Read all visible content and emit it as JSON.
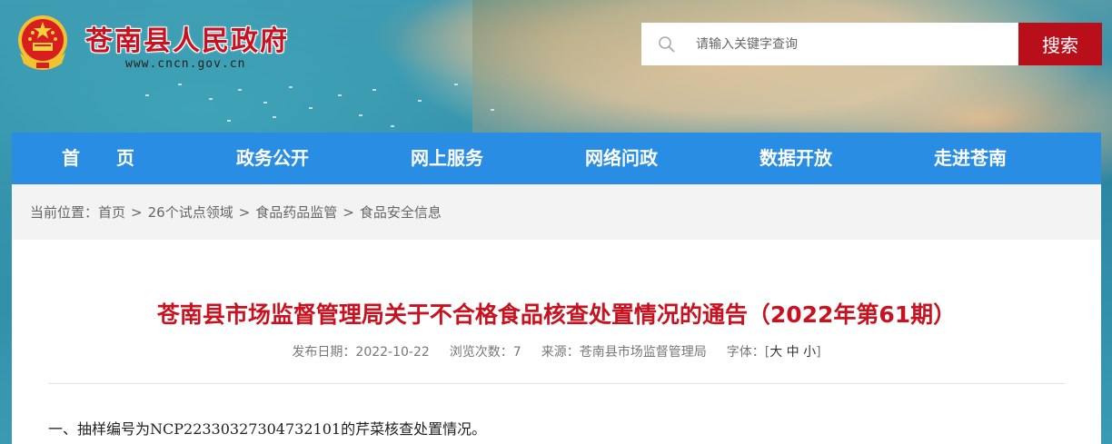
{
  "header": {
    "site_name": "苍南县人民政府",
    "site_url": "www.cncn.gov.cn",
    "emblem": "national-emblem-icon"
  },
  "search": {
    "placeholder": "请输入关键字查询",
    "button_label": "搜索"
  },
  "nav": {
    "items": [
      {
        "label": "首　　页"
      },
      {
        "label": "政务公开"
      },
      {
        "label": "网上服务"
      },
      {
        "label": "网络问政"
      },
      {
        "label": "数据开放"
      },
      {
        "label": "走进苍南"
      }
    ]
  },
  "breadcrumb": {
    "prefix": "当前位置：",
    "items": [
      "首页",
      "26个试点领域",
      "食品药品监管",
      "食品安全信息"
    ],
    "separator": ">"
  },
  "article": {
    "title": "苍南县市场监督管理局关于不合格食品核查处置情况的通告（2022年第61期）",
    "publish_date": "发布日期：2022-10-22",
    "views": "浏览次数：7",
    "source": "来源：苍南县市场监督管理局",
    "font_label": "字体：[",
    "font_large": "大",
    "font_medium": "中",
    "font_small": "小",
    "font_close": "]",
    "paragraph_1": "一、抽样编号为NCP22330327304732101的芹菜核查处置情况。"
  },
  "colors": {
    "brand_red": "#c8121f",
    "search_button": "#b80f1a",
    "nav_blue": "#2a8de4"
  }
}
